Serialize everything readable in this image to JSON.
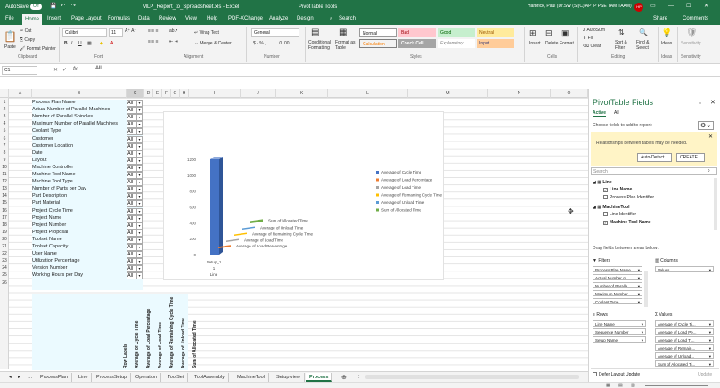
{
  "titlebar": {
    "autosave": "AutoSave",
    "autosave_state": "Off",
    "filename": "MLP_Report_to_Spreadsheet.xls - Excel",
    "context_tab": "PivotTable Tools",
    "user": "Harbrick, Paul (Dr.SW (SI)C) AP IP PSE TAM TAAM)",
    "initials": "HP"
  },
  "menu": {
    "items": [
      "File",
      "Home",
      "Insert",
      "Page Layout",
      "Formulas",
      "Data",
      "Review",
      "View",
      "Help",
      "PDF-XChange",
      "Analyze",
      "Design"
    ],
    "search": "Search",
    "share": "Share",
    "comments": "Comments"
  },
  "ribbon": {
    "clipboard": {
      "cut": "Cut",
      "copy": "Copy",
      "format_painter": "Format Painter",
      "paste": "Paste",
      "label": "Clipboard"
    },
    "font": {
      "name": "Calibri",
      "size": "11",
      "label": "Font"
    },
    "alignment": {
      "wrap": "Wrap Text",
      "merge": "Merge & Center",
      "label": "Alignment"
    },
    "number": {
      "format": "General",
      "label": "Number"
    },
    "styles": {
      "cond": "Conditional Formatting",
      "format_table": "Format as Table",
      "normal": "Normal",
      "bad": "Bad",
      "good": "Good",
      "neutral": "Neutral",
      "calculation": "Calculation",
      "check_cell": "Check Cell",
      "explanatory": "Explanatory...",
      "input": "Input",
      "label": "Styles"
    },
    "cells": {
      "insert": "Insert",
      "delete": "Delete",
      "format": "Format",
      "label": "Cells"
    },
    "editing": {
      "autosum": "AutoSum",
      "fill": "Fill",
      "clear": "Clear",
      "sort": "Sort & Filter",
      "find": "Find & Select",
      "label": "Editing"
    },
    "ideas": {
      "ideas": "Ideas",
      "label": "Ideas"
    },
    "sensitivity": {
      "sensitivity": "Sensitivity",
      "label": "Sensitivity"
    }
  },
  "formula_bar": {
    "cell_ref": "C1",
    "fx": "fx",
    "value": "All"
  },
  "columns": [
    "A",
    "B",
    "C",
    "D",
    "E",
    "F",
    "G",
    "H",
    "I",
    "J",
    "K",
    "L",
    "M",
    "N",
    "O"
  ],
  "rows": {
    "numbers": [
      "1",
      "2",
      "3",
      "4",
      "5",
      "6",
      "7",
      "8",
      "9",
      "10",
      "11",
      "12",
      "13",
      "14",
      "15",
      "16",
      "17",
      "18",
      "19",
      "20",
      "21",
      "22",
      "23",
      "24",
      "25",
      "26"
    ],
    "labels": [
      "Process Plan Name",
      "Actual Number of Parallel Machines",
      "Number of Parallel Spindles",
      "Maximum Number of Parallel Machines",
      "Coolant Type",
      "Customer",
      "Customer Location",
      "Date",
      "Layout",
      "Machine Controller",
      "Machine Tool Name",
      "Machine Tool Type",
      "Number of Parts per Day",
      "Part Description",
      "Part Material",
      "Project Cycle Time",
      "Project Name",
      "Project Number",
      "Project Proposal",
      "Toolset Name",
      "Toolset Capacity",
      "User Name",
      "Utilization Percentage",
      "Version Number",
      "Working Hours per Day"
    ],
    "filter_value": "All"
  },
  "vertical_headers": [
    "Row Labels",
    "Average of Cycle Time",
    "Average of Load Percentage",
    "Average of Load Time",
    "Average of Remaining Cycle Time",
    "Average of Unload Time",
    "Sum of Allocated Time"
  ],
  "chart_data": {
    "type": "bar",
    "categories": [
      "Setup_1"
    ],
    "category_sub": [
      "1"
    ],
    "category_title": "Line",
    "yticks": [
      0,
      200,
      400,
      600,
      800,
      1000,
      1200
    ],
    "ylim": [
      0,
      1200
    ],
    "series": [
      {
        "name": "Average of Cycle Time",
        "values": [
          1200
        ]
      },
      {
        "name": "Average of Load Percentage",
        "values": [
          20
        ]
      },
      {
        "name": "Average of Load Time",
        "values": [
          15
        ]
      },
      {
        "name": "Average of Remaining Cycle Time",
        "values": [
          10
        ]
      },
      {
        "name": "Average of Unload Time",
        "values": [
          15
        ]
      },
      {
        "name": "Sum of Allocated Time",
        "values": [
          30
        ]
      }
    ],
    "colors": [
      "#4472c4",
      "#ed7d31",
      "#a5a5a5",
      "#ffc000",
      "#5b9bd5",
      "#70ad47"
    ]
  },
  "sheets": {
    "tabs": [
      "ProcessPlan",
      "Line",
      "ProcessSetup",
      "Operation",
      "ToolSet",
      "ToolAssembly",
      "MachineTool",
      "Setup view",
      "Process"
    ],
    "active": "Process"
  },
  "pivot": {
    "title": "PivotTable Fields",
    "tab_active": "Active",
    "tab_all": "All",
    "choose": "Choose fields to add to report:",
    "relationships": "Relationships between tables may be needed.",
    "auto_detect": "Auto-Detect...",
    "create": "CREATE...",
    "search": "Search",
    "tree": [
      {
        "name": "Line",
        "children": [
          {
            "label": "Line Name",
            "checked": true
          },
          {
            "label": "Process Plan Identifier",
            "checked": false
          }
        ]
      },
      {
        "name": "MachineTool",
        "children": [
          {
            "label": "Line Identifier",
            "checked": false
          },
          {
            "label": "Machine Tool Name",
            "checked": true
          }
        ]
      }
    ],
    "drag": "Drag fields between areas below:",
    "filters_label": "Filters",
    "columns_label": "Columns",
    "rows_label": "Rows",
    "values_label": "Values",
    "filters": [
      "Process Plan Name",
      "Actual Number of...",
      "Number of Paralle...",
      "Maximum Number...",
      "Coolant Type"
    ],
    "columns": [
      "Values"
    ],
    "rows_list": [
      "Line Name",
      "Sequence Number",
      "Setup Name"
    ],
    "values": [
      "Average of Cycle Ti...",
      "Average of Load Pe...",
      "Average of Load Ti...",
      "Average of Remain...",
      "Average of Unload...",
      "Sum of Allocated Ti..."
    ],
    "defer": "Defer Layout Update",
    "update": "Update"
  }
}
